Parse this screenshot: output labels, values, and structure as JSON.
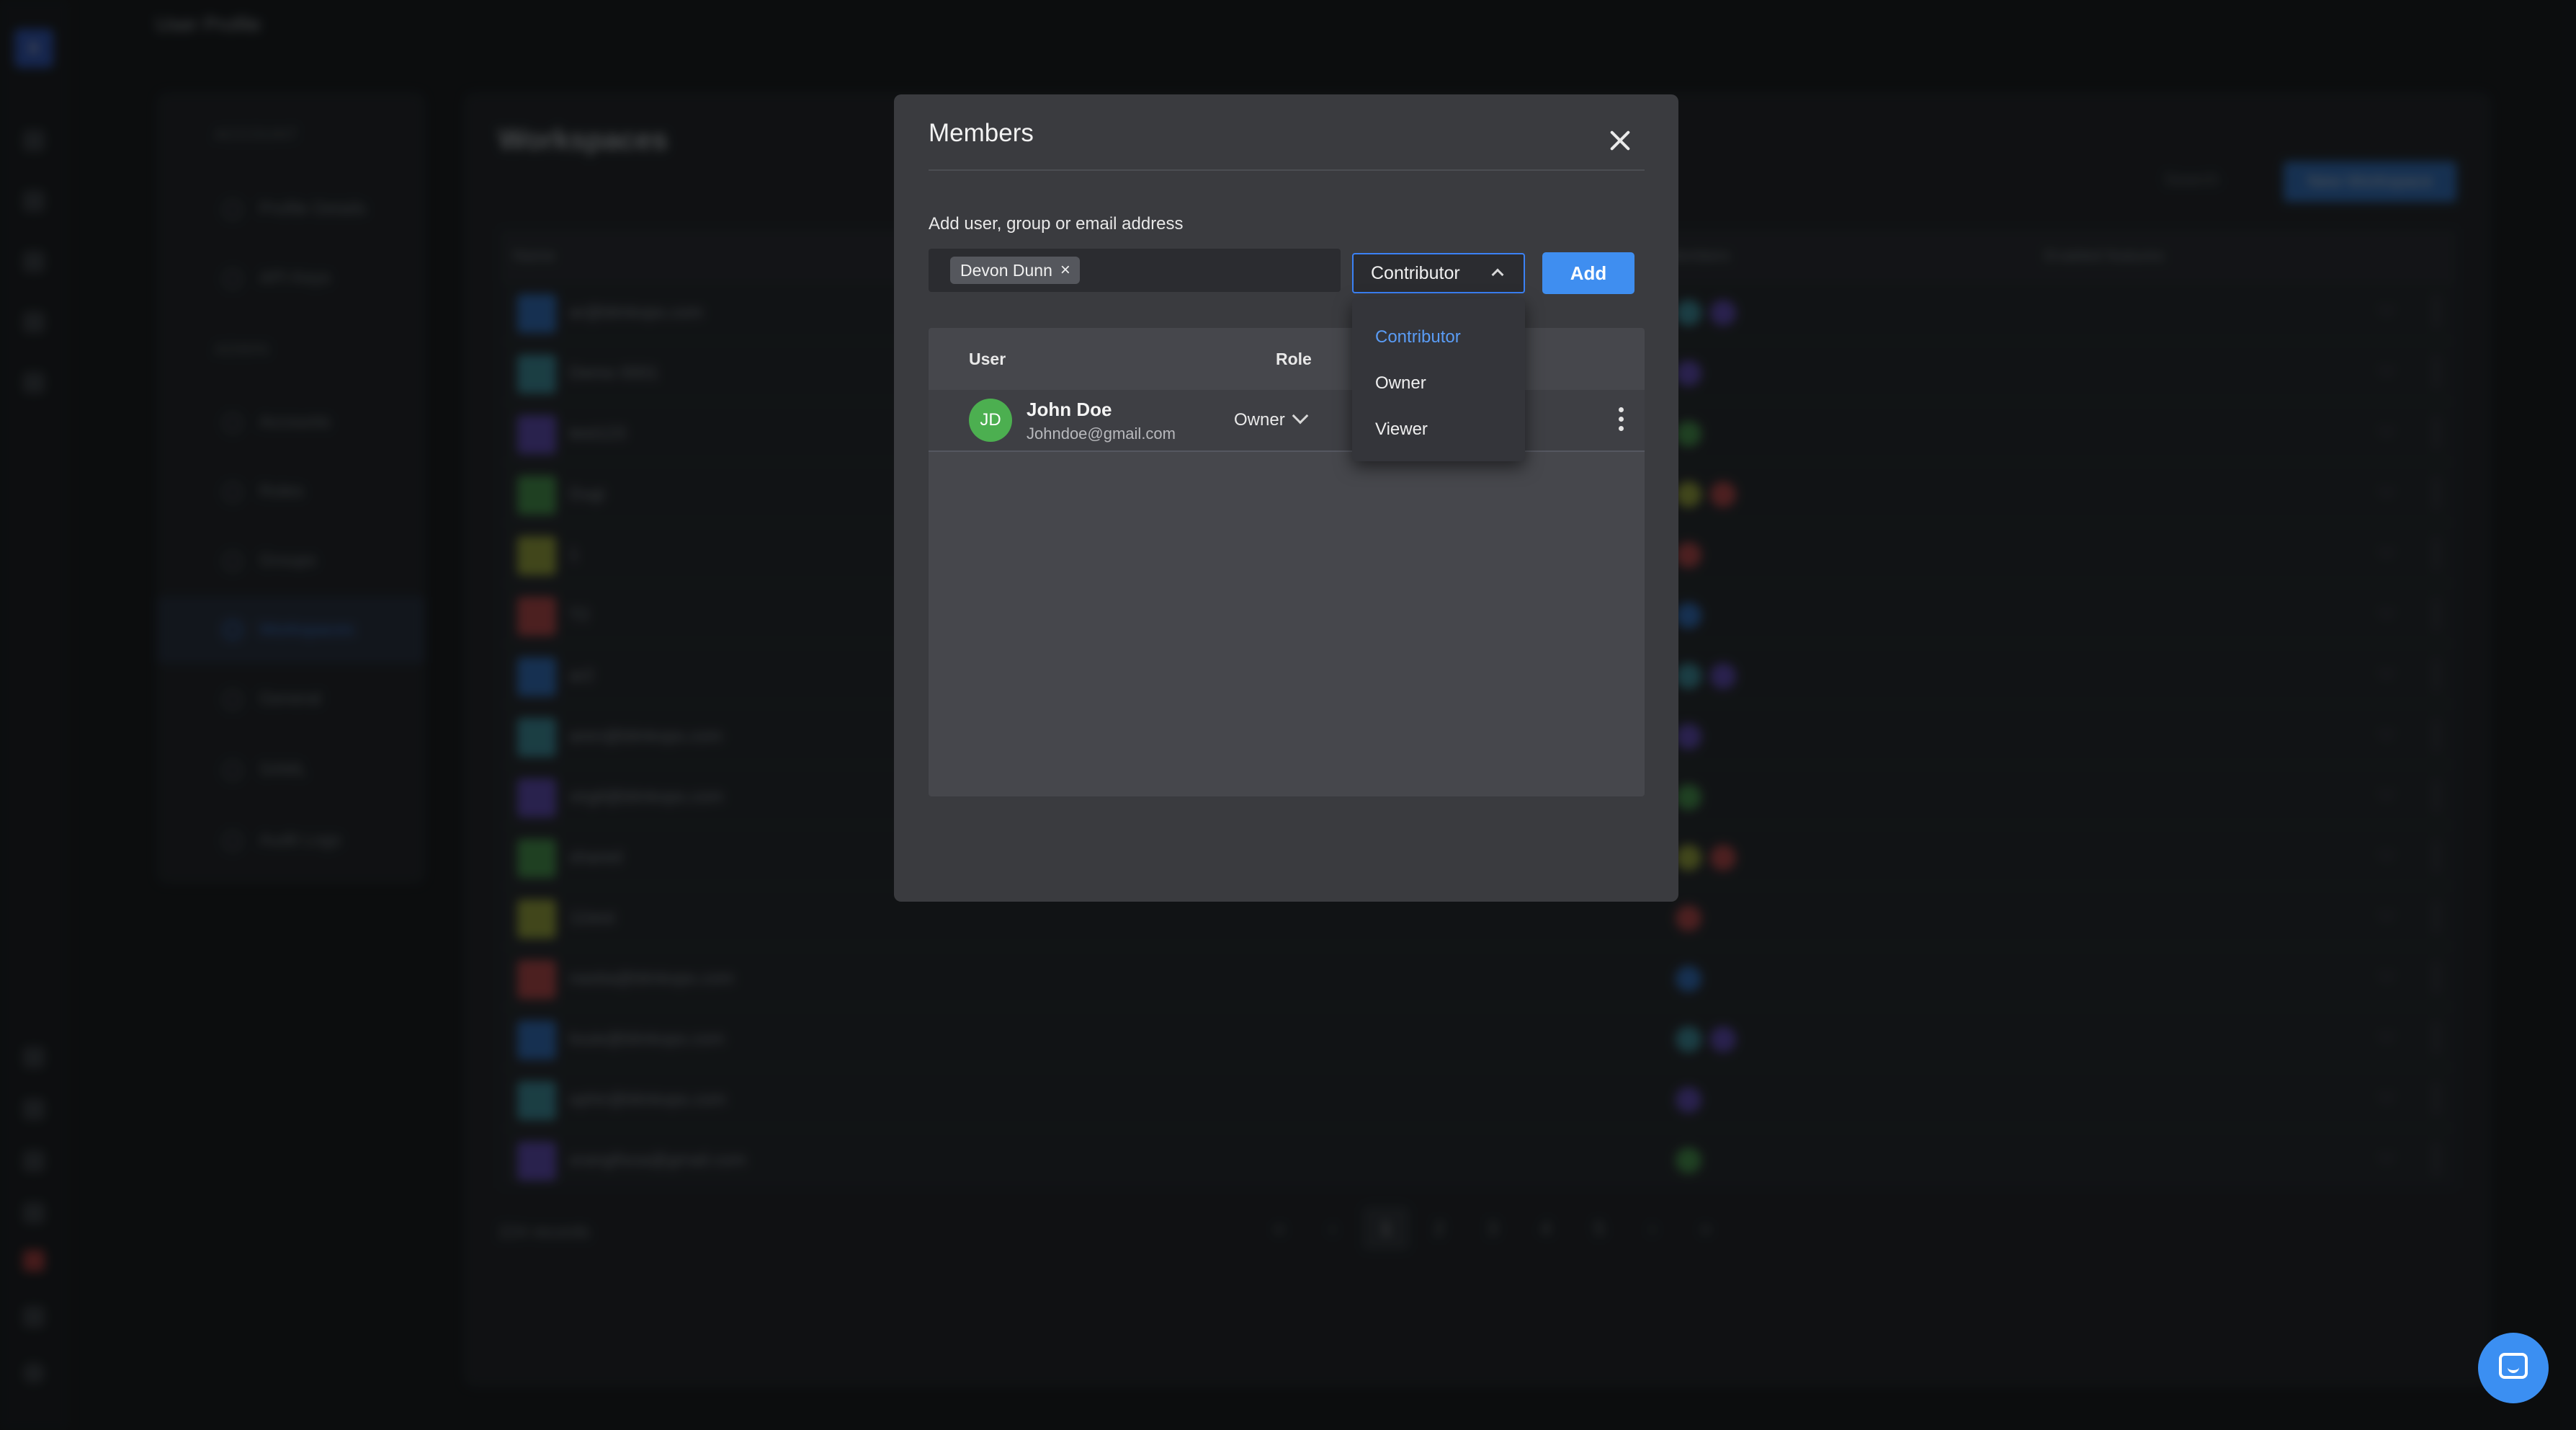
{
  "background": {
    "page_title": "User Profile",
    "nav_section_account": "ACCOUNT",
    "nav_section_admin": "ADMIN",
    "nav_items": [
      "Profile Details",
      "API Keys",
      "Accounts",
      "Roles",
      "Groups",
      "Workspaces",
      "General",
      "SAML",
      "Audit Logs"
    ],
    "main_title": "Workspaces",
    "search_label": "Search",
    "new_button": "New Workspace",
    "columns": [
      "Name",
      "Members",
      "Enabled features"
    ],
    "rows": [
      "ar@blinkops.com",
      "Demo 0001",
      "test123",
      "Dugi",
      "1",
      "T2",
      "ar2",
      "aren@blinkops.com",
      "virgil@blinkops.com",
      "shared",
      "11test",
      "nastia@blinkops.com",
      "louie@blinkops.com",
      "ophir@blinkops.com",
      "orangfisoa@gmail.com"
    ],
    "records": "224 records",
    "pages": [
      "«",
      "‹",
      "1",
      "2",
      "3",
      "4",
      "5",
      "›",
      "»"
    ]
  },
  "modal": {
    "title": "Members",
    "add_label": "Add user, group or email address",
    "chip_value": "Devon Dunn",
    "chip_remove": "×",
    "role_selected": "Contributor",
    "add_button": "Add",
    "table_headers": {
      "user": "User",
      "role": "Role"
    },
    "member": {
      "initials": "JD",
      "name": "John Doe",
      "email": "Johndoe@gmail.com",
      "role": "Owner"
    }
  },
  "dropdown": {
    "options": [
      "Contributor",
      "Owner",
      "Viewer"
    ],
    "selected": "Contributor"
  },
  "colors": {
    "accent": "#3b82f6",
    "avatar_green": "#4caf50",
    "modal_bg": "#3a3b3f"
  },
  "icons": {
    "close": "close-icon",
    "chip_remove": "close-icon",
    "dropdown": "chevron-up-icon",
    "role": "chevron-down-icon",
    "row_menu": "kebab-icon",
    "chat": "chat-icon"
  }
}
